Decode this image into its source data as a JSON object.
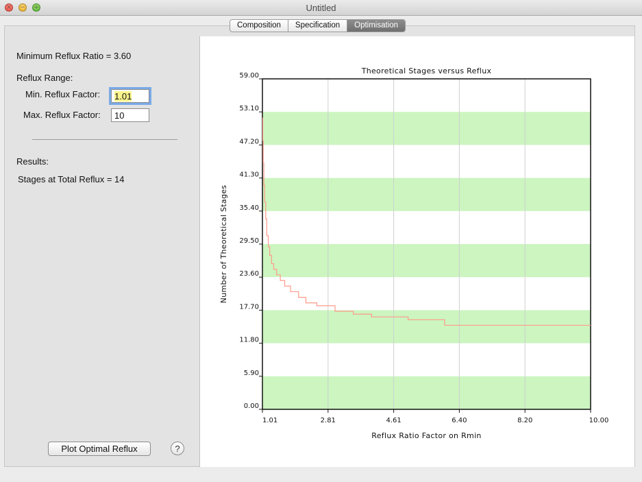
{
  "window": {
    "title": "Untitled",
    "close_glyph": "×",
    "min_glyph": "−",
    "max_glyph": "+"
  },
  "tabs": [
    {
      "label": "Composition",
      "active": false
    },
    {
      "label": "Specification",
      "active": false
    },
    {
      "label": "Optimisation",
      "active": true
    }
  ],
  "left": {
    "min_reflux_ratio": "Minimum Reflux Ratio = 3.60",
    "reflux_range": "Reflux Range:",
    "min_factor_label": "Min. Reflux Factor:",
    "min_factor_value": "1.01",
    "max_factor_label": "Max. Reflux Factor:",
    "max_factor_value": "10",
    "results_label": "Results:",
    "stages_total": "Stages at Total Reflux = 14",
    "plot_button": "Plot Optimal Reflux",
    "help_button": "?"
  },
  "colors": {
    "band": "#ccf5c0",
    "curve": "#ff9a8a",
    "grid": "#cfcfcf"
  },
  "chart_data": {
    "type": "line",
    "title": "Theoretical Stages versus Reflux",
    "xlabel": "Reflux Ratio Factor on Rmin",
    "ylabel": "Number of Theoretical Stages",
    "xlim": [
      1.01,
      10.0
    ],
    "ylim": [
      0.0,
      59.0
    ],
    "x_ticks": [
      "1.01",
      "2.81",
      "4.61",
      "6.40",
      "8.20",
      "10.00"
    ],
    "y_ticks": [
      "0.00",
      "5.90",
      "11.80",
      "17.70",
      "23.60",
      "29.50",
      "35.40",
      "41.30",
      "47.20",
      "53.10",
      "59.00"
    ],
    "series": [
      {
        "x": [
          1.01,
          1.02,
          1.03,
          1.05,
          1.07,
          1.1,
          1.13,
          1.17,
          1.21,
          1.26,
          1.32,
          1.4,
          1.5,
          1.62,
          1.78,
          2.0,
          2.2,
          2.5,
          3.0,
          3.5,
          4.0,
          5.0,
          6.0,
          8.0,
          10.0
        ],
        "y": [
          52.0,
          48.0,
          44.0,
          40.0,
          37.0,
          34.0,
          31.0,
          29.0,
          27.5,
          26.0,
          25.0,
          24.0,
          23.0,
          22.0,
          21.0,
          20.0,
          19.0,
          18.5,
          17.5,
          17.0,
          16.5,
          16.0,
          15.0,
          15.0,
          15.0
        ]
      }
    ]
  }
}
